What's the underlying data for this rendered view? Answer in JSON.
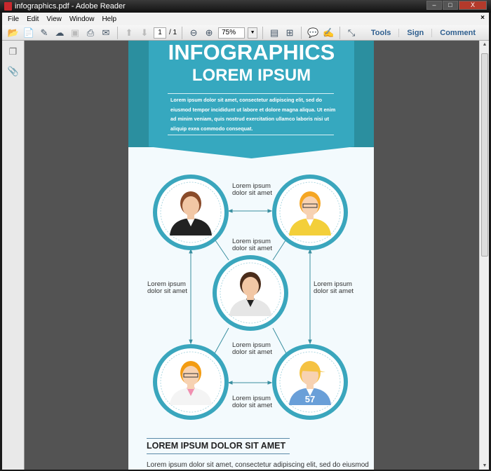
{
  "window": {
    "title": "infographics.pdf - Adobe Reader",
    "controls": [
      "–",
      "□",
      "X"
    ]
  },
  "menu": [
    "File",
    "Edit",
    "View",
    "Window",
    "Help"
  ],
  "toolbar": {
    "page_current": "1",
    "page_total": "/ 1",
    "zoom": "75%",
    "links": [
      "Tools",
      "Sign",
      "Comment"
    ]
  },
  "doc": {
    "title1": "INFOGRAPHICS",
    "title2": "LOREM IPSUM",
    "intro": [
      "Lorem ipsum dolor sit amet, consectetur adipiscing elit, sed do",
      "eiusmod tempor incididunt ut labore et dolore magna aliqua. Ut enim",
      "ad minim veniam, quis nostrud exercitation ullamco laboris nisi ut",
      "aliquip exea commodo consequat."
    ],
    "labels": {
      "top": [
        "Lorem ipsum",
        "dolor sit amet"
      ],
      "center_top": [
        "Lorem ipsum",
        "dolor sit amet"
      ],
      "left": [
        "Lorem ipsum",
        "dolor sit amet"
      ],
      "right": [
        "Lorem ipsum",
        "dolor sit amet"
      ],
      "center_bottom": [
        "Lorem ipsum",
        "dolor sit amet"
      ],
      "bottom": [
        "Lorem ipsum",
        "dolor sit amet"
      ]
    },
    "jersey": "57",
    "section_title": "LOREM IPSUM DOLOR SIT AMET",
    "section_text": "Lorem ipsum dolor sit amet, consectetur adipiscing elit, sed do eiusmod"
  },
  "colors": {
    "teal_dark": "#2b8f9f",
    "teal": "#36a8bf",
    "ring": "#3aa6bd"
  }
}
